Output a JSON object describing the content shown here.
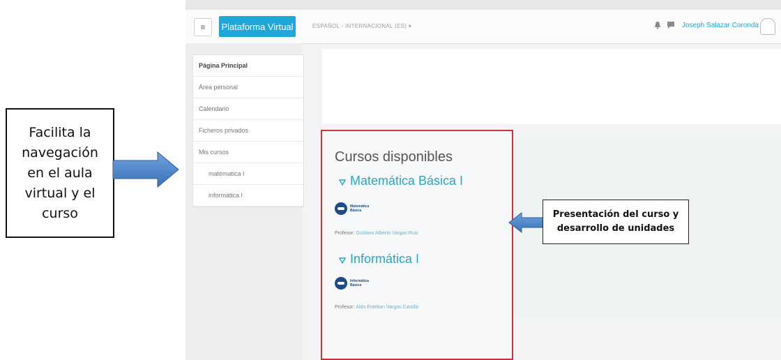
{
  "annotations": {
    "left_note": [
      "Facilita la",
      "navegación",
      "en el aula",
      "virtual y el",
      "curso"
    ],
    "right_note": [
      "Presentación del curso y",
      "desarrollo de unidades"
    ]
  },
  "navbar": {
    "menu_icon": "hamburger-icon",
    "brand": "Plataforma Virtual",
    "language": "ESPAÑOL - INTERNACIONAL (ES) ▾",
    "user_name": "Joseph Salazar Coronda"
  },
  "sidebar": {
    "items": [
      {
        "label": "Página Principal"
      },
      {
        "label": "Área personal"
      },
      {
        "label": "Calendario"
      },
      {
        "label": "Ficheros privados"
      },
      {
        "label": "Mis cursos"
      },
      {
        "label": "matematica I"
      },
      {
        "label": "informática I"
      }
    ]
  },
  "main": {
    "heading": "Cursos disponibles",
    "courses": [
      {
        "title": "Matemática Básica I",
        "logo_text": [
          "Matemática",
          "Básica"
        ],
        "teacher_label": "Profesor:",
        "teacher": "Gustavo Alberto Vargas Ruiz"
      },
      {
        "title": "Informática I",
        "logo_text": [
          "Informática",
          "Básica"
        ],
        "teacher_label": "Profesor:",
        "teacher": "Aldo Esteban Vargas Castillo"
      }
    ]
  },
  "colors": {
    "brand": "#1fa7d9",
    "link": "#27a6c8",
    "highlight_border": "#c9343a",
    "arrow": "#4a86c7"
  }
}
